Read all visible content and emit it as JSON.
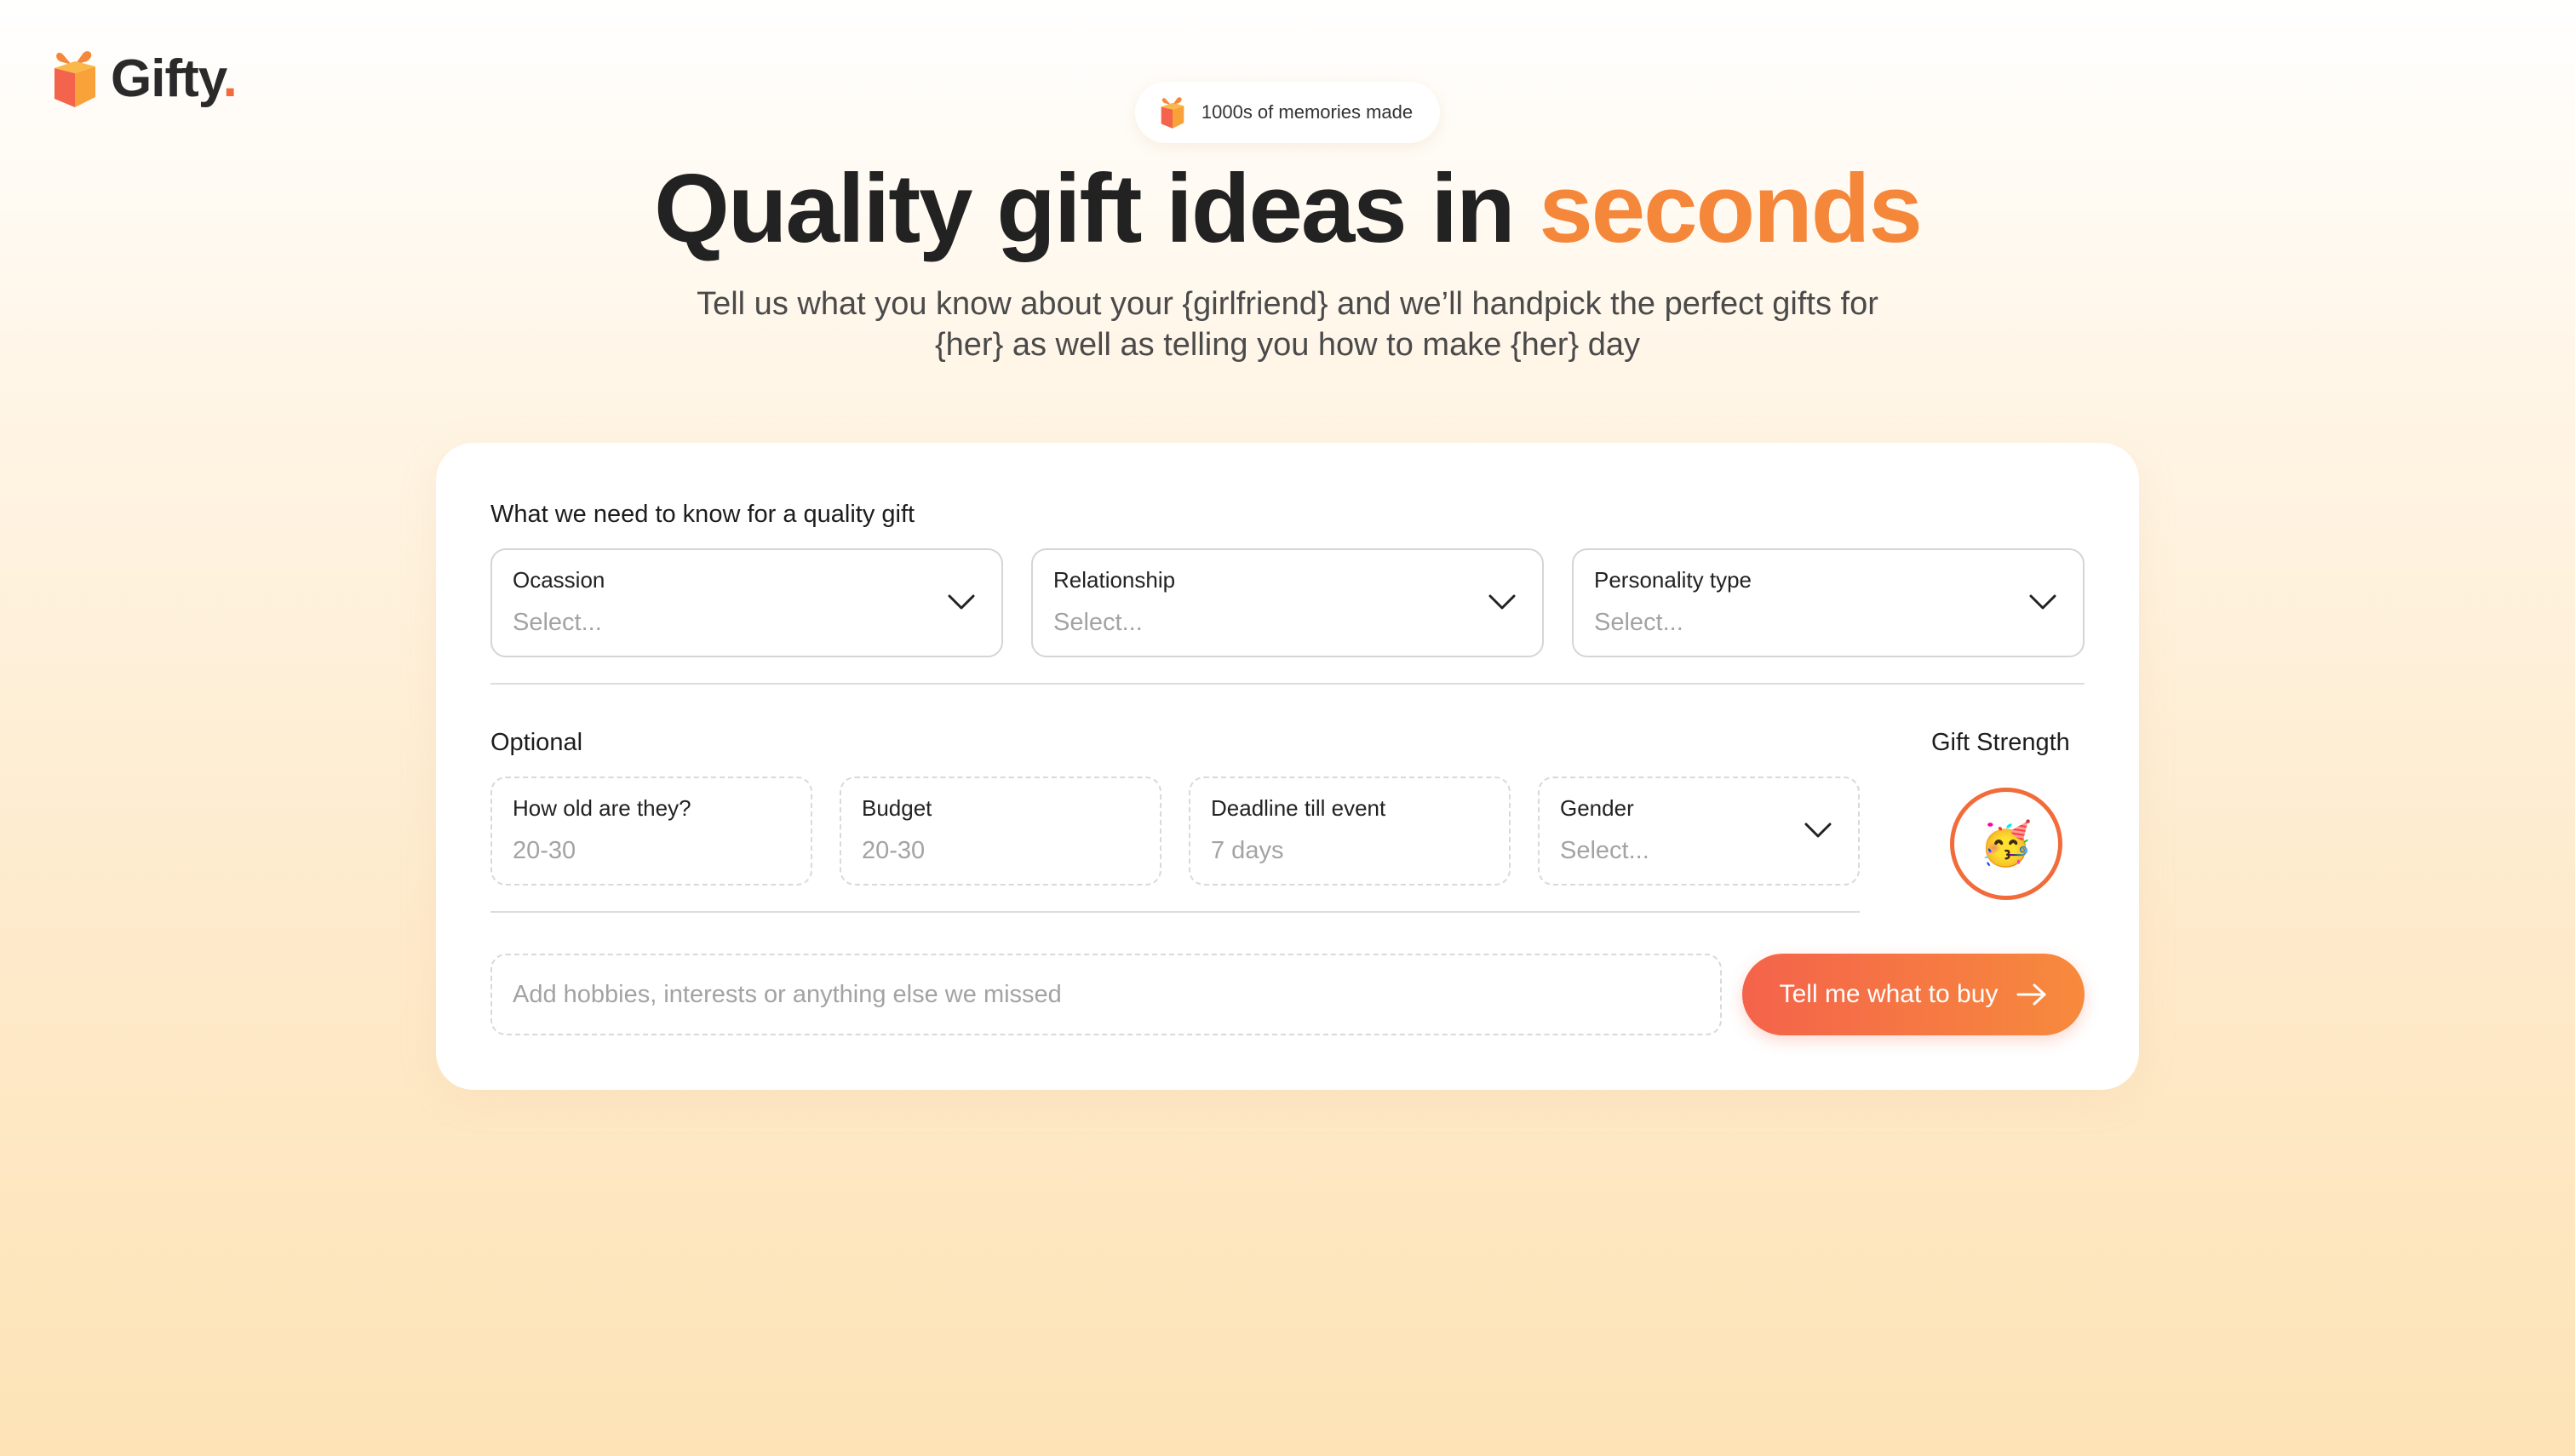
{
  "brand": {
    "name": "Gifty",
    "dot": ".",
    "accent_color": "#f26b3a"
  },
  "hero": {
    "badge_text": "1000s of memories made",
    "headline_main": "Quality gift ideas in",
    "headline_accent": "seconds",
    "subline_1": "Tell us what you know about your {girlfriend} and we’ll handpick the perfect gifts for",
    "subline_2": "{her} as well as telling you how to make {her} day"
  },
  "required": {
    "title": "What we need to know for a quality gift",
    "fields": [
      {
        "label": "Ocassion",
        "value": "Select..."
      },
      {
        "label": "Relationship",
        "value": "Select..."
      },
      {
        "label": "Personality type",
        "value": "Select..."
      }
    ]
  },
  "optional": {
    "title": "Optional",
    "fields": [
      {
        "label": "How old are they?",
        "value": "20-30"
      },
      {
        "label": "Budget",
        "value": "20-30"
      },
      {
        "label": "Deadline till event",
        "value": "7 days"
      },
      {
        "label": "Gender",
        "value": "Select..."
      }
    ]
  },
  "strength": {
    "title": "Gift Strength",
    "emoji": "🥳",
    "icon": "party-face-icon"
  },
  "notes": {
    "placeholder": "Add hobbies, interests or anything else we missed"
  },
  "cta": {
    "label": "Tell me what to buy",
    "icon": "arrow-right-icon"
  }
}
